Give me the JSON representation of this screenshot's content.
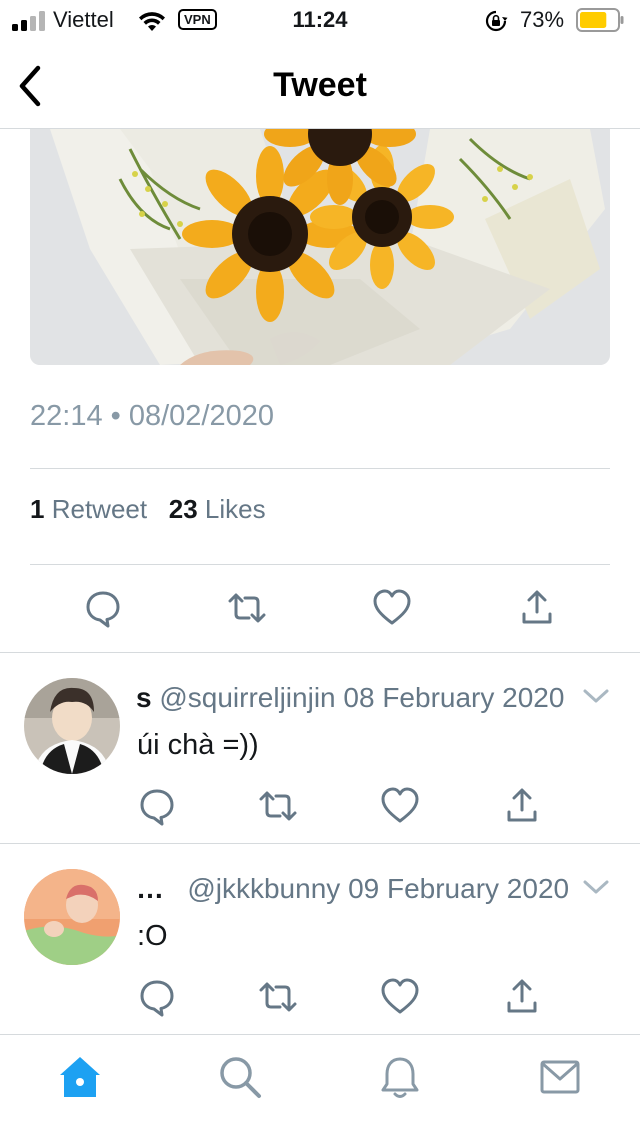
{
  "status_bar": {
    "carrier": "Viettel",
    "vpn": "VPN",
    "time": "11:24",
    "battery_pct": "73%",
    "battery_level": 0.73
  },
  "nav": {
    "title": "Tweet",
    "back_icon": "chevron-left-icon"
  },
  "tweet": {
    "timestamp": "22:14 • 08/02/2020",
    "retweet_count": "1",
    "retweet_label": "Retweet",
    "likes_count": "23",
    "likes_label": "Likes"
  },
  "replies": [
    {
      "name": "s",
      "handle": "@squirreljinjin",
      "date": "08 February 2020",
      "text": "úi chà =))"
    },
    {
      "name": "…",
      "handle": "@jkkkbunny",
      "date": "09 February 2020",
      "text": ":O"
    }
  ],
  "tabbar": {
    "icons": [
      "home-icon",
      "search-icon",
      "bell-icon",
      "mail-icon"
    ],
    "active": "home-icon"
  },
  "colors": {
    "accent": "#1da1f2",
    "icon_gray": "#657786",
    "text_gray": "#8899a6",
    "battery": "#ffcc00"
  }
}
